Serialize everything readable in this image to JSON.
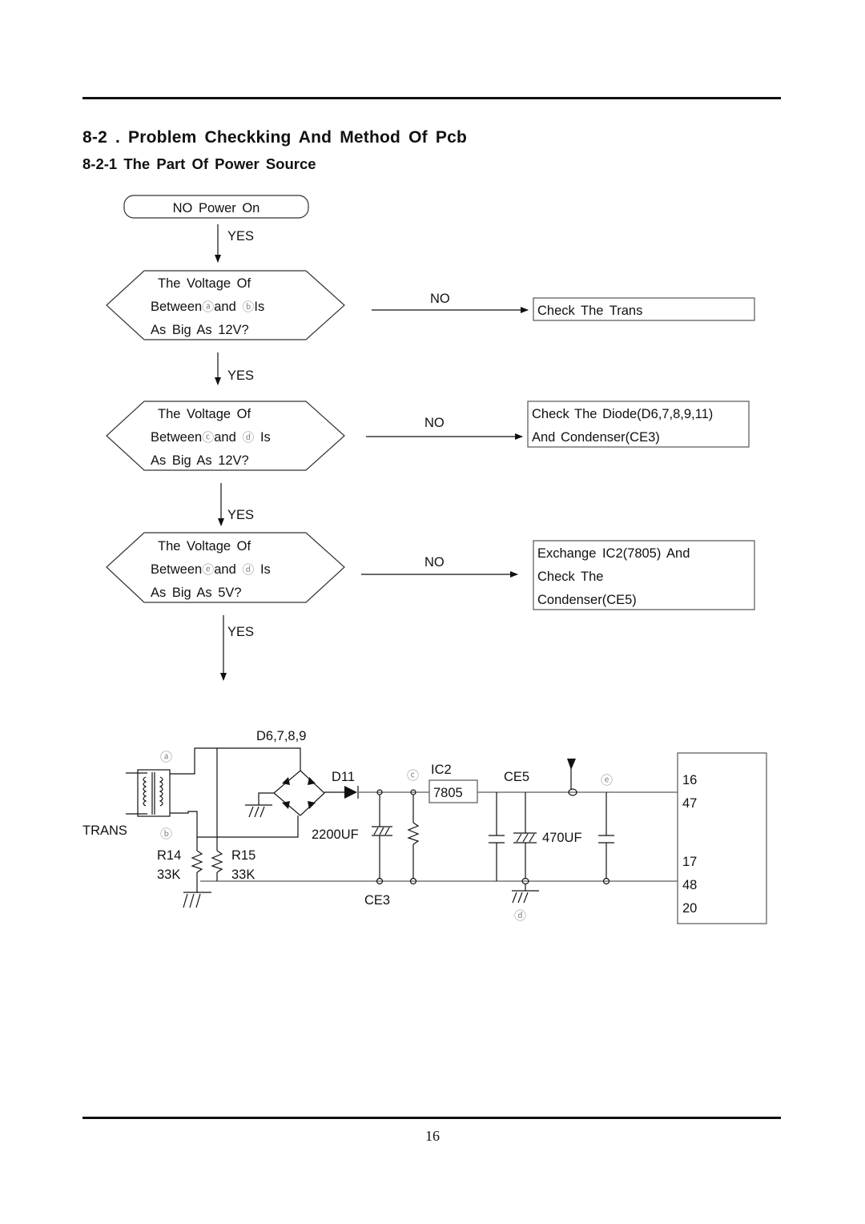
{
  "header": {
    "section_title": "8-2 . Problem Checkking And Method Of Pcb",
    "subsection_title": "8-2-1 The Part Of Power Source"
  },
  "flowchart": {
    "start": "NO Power On",
    "yes_label": "YES",
    "no_label": "NO",
    "decisions": [
      {
        "line1": "The Voltage Of",
        "line2_prefix": "Between",
        "marker_a": "ⓐ",
        "line2_mid": "and ",
        "marker_b": "ⓑ",
        "line2_suffix": "Is",
        "line3": "As Big As 12V?",
        "action_lines": [
          "Check The Trans"
        ]
      },
      {
        "line1": "The Voltage Of",
        "line2_prefix": "Between",
        "marker_a": "ⓒ",
        "line2_mid": "and ",
        "marker_b": "ⓓ",
        "line2_suffix": " Is",
        "line3": "As Big As 12V?",
        "action_lines": [
          "Check The Diode(D6,7,8,9,11)",
          "And Condenser(CE3)"
        ]
      },
      {
        "line1": "The Voltage Of",
        "line2_prefix": "Between",
        "marker_a": "ⓔ",
        "line2_mid": "and ",
        "marker_b": "ⓓ",
        "line2_suffix": " Is",
        "line3": "As Big As 5V?",
        "action_lines": [
          "Exchange IC2(7805) And",
          "Check The",
          "Condenser(CE5)"
        ]
      }
    ]
  },
  "schematic": {
    "trans_label": "TRANS",
    "bridge_label": "D6,7,8,9",
    "diode_label": "D11",
    "r14_name": "R14",
    "r14_value": "33K",
    "r15_name": "R15",
    "r15_value": "33K",
    "ce3_value": "2200UF",
    "ce3_name": "CE3",
    "ic_name": "IC2",
    "ic_part": "7805",
    "ce5_name": "CE5",
    "ce5_value": "470UF",
    "markers": {
      "a": "ⓐ",
      "b": "ⓑ",
      "c": "ⓒ",
      "d": "ⓓ",
      "e": "ⓔ"
    },
    "mcu_pins": [
      "16",
      "47",
      "17",
      "48",
      "20"
    ]
  },
  "footer": {
    "page_number": "16"
  }
}
